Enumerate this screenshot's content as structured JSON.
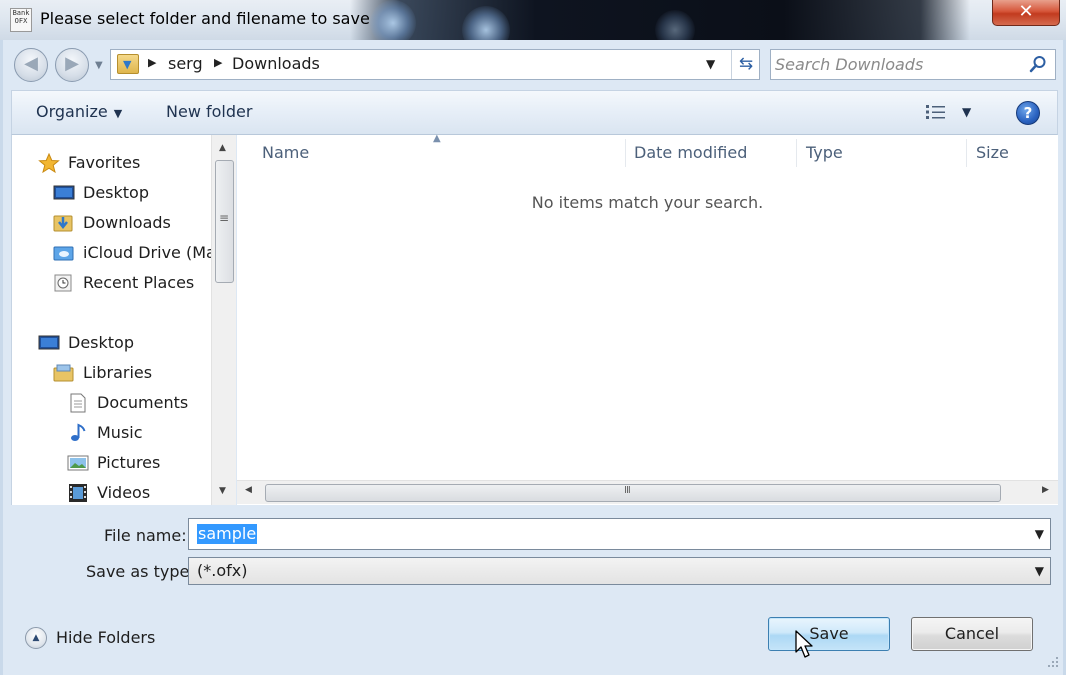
{
  "window": {
    "title": "Please select folder and filename to save",
    "app_icon_text": "Bank OFX",
    "close_label": "✕"
  },
  "address": {
    "crumbs": [
      "serg",
      "Downloads"
    ],
    "search_placeholder": "Search Downloads"
  },
  "toolbar": {
    "organize_label": "Organize",
    "new_folder_label": "New folder",
    "help_label": "?"
  },
  "sidebar": {
    "items": [
      {
        "label": "Favorites",
        "icon": "star-icon"
      },
      {
        "label": "Desktop",
        "icon": "desktop-icon"
      },
      {
        "label": "Downloads",
        "icon": "downloads-folder-icon"
      },
      {
        "label": "iCloud Drive (Ma",
        "icon": "icloud-drive-icon"
      },
      {
        "label": "Recent Places",
        "icon": "recent-places-icon"
      },
      {
        "label": "Desktop",
        "icon": "desktop-icon"
      },
      {
        "label": "Libraries",
        "icon": "libraries-icon"
      },
      {
        "label": "Documents",
        "icon": "documents-icon"
      },
      {
        "label": "Music",
        "icon": "music-icon"
      },
      {
        "label": "Pictures",
        "icon": "pictures-icon"
      },
      {
        "label": "Videos",
        "icon": "videos-icon"
      }
    ]
  },
  "filelist": {
    "columns": [
      "Name",
      "Date modified",
      "Type",
      "Size"
    ],
    "empty_message": "No items match your search."
  },
  "form": {
    "filename_label": "File name:",
    "filename_value": "sample",
    "type_label": "Save as type:",
    "type_value": "(*.ofx)"
  },
  "footer": {
    "hide_folders_label": "Hide Folders",
    "save_label": "Save",
    "cancel_label": "Cancel"
  },
  "colors": {
    "selection": "#3399ff",
    "close_button": "#c94a2d",
    "help_icon": "#2a62c0",
    "save_button_border": "#3c7fb1"
  }
}
